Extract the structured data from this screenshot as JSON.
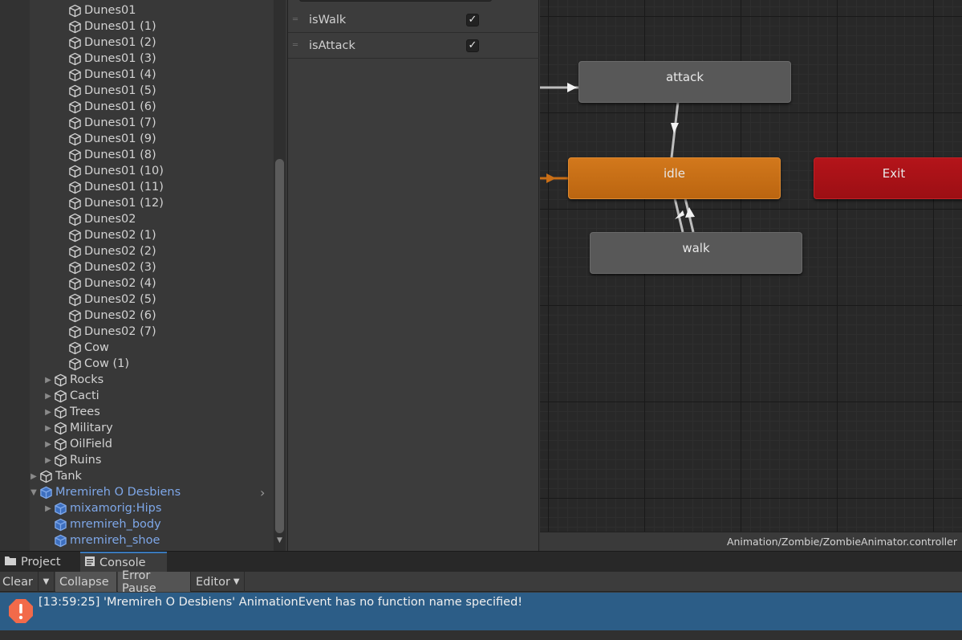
{
  "hierarchy": {
    "items": [
      {
        "label": "Dunes01",
        "indent": 6,
        "arrow": false,
        "prefab": false
      },
      {
        "label": "Dunes01 (1)",
        "indent": 6,
        "arrow": false,
        "prefab": false
      },
      {
        "label": "Dunes01 (2)",
        "indent": 6,
        "arrow": false,
        "prefab": false
      },
      {
        "label": "Dunes01 (3)",
        "indent": 6,
        "arrow": false,
        "prefab": false
      },
      {
        "label": "Dunes01 (4)",
        "indent": 6,
        "arrow": false,
        "prefab": false
      },
      {
        "label": "Dunes01 (5)",
        "indent": 6,
        "arrow": false,
        "prefab": false
      },
      {
        "label": "Dunes01 (6)",
        "indent": 6,
        "arrow": false,
        "prefab": false
      },
      {
        "label": "Dunes01 (7)",
        "indent": 6,
        "arrow": false,
        "prefab": false
      },
      {
        "label": "Dunes01 (9)",
        "indent": 6,
        "arrow": false,
        "prefab": false
      },
      {
        "label": "Dunes01 (8)",
        "indent": 6,
        "arrow": false,
        "prefab": false
      },
      {
        "label": "Dunes01 (10)",
        "indent": 6,
        "arrow": false,
        "prefab": false
      },
      {
        "label": "Dunes01 (11)",
        "indent": 6,
        "arrow": false,
        "prefab": false
      },
      {
        "label": "Dunes01 (12)",
        "indent": 6,
        "arrow": false,
        "prefab": false
      },
      {
        "label": "Dunes02",
        "indent": 6,
        "arrow": false,
        "prefab": false
      },
      {
        "label": "Dunes02 (1)",
        "indent": 6,
        "arrow": false,
        "prefab": false
      },
      {
        "label": "Dunes02 (2)",
        "indent": 6,
        "arrow": false,
        "prefab": false
      },
      {
        "label": "Dunes02 (3)",
        "indent": 6,
        "arrow": false,
        "prefab": false
      },
      {
        "label": "Dunes02 (4)",
        "indent": 6,
        "arrow": false,
        "prefab": false
      },
      {
        "label": "Dunes02 (5)",
        "indent": 6,
        "arrow": false,
        "prefab": false
      },
      {
        "label": "Dunes02 (6)",
        "indent": 6,
        "arrow": false,
        "prefab": false
      },
      {
        "label": "Dunes02 (7)",
        "indent": 6,
        "arrow": false,
        "prefab": false
      },
      {
        "label": "Cow",
        "indent": 6,
        "arrow": false,
        "prefab": false
      },
      {
        "label": "Cow (1)",
        "indent": 6,
        "arrow": false,
        "prefab": false
      },
      {
        "label": "Rocks",
        "indent": 5,
        "arrow": "right",
        "prefab": false
      },
      {
        "label": "Cacti",
        "indent": 5,
        "arrow": "right",
        "prefab": false
      },
      {
        "label": "Trees",
        "indent": 5,
        "arrow": "right",
        "prefab": false
      },
      {
        "label": "Military",
        "indent": 5,
        "arrow": "right",
        "prefab": false
      },
      {
        "label": "OilField",
        "indent": 5,
        "arrow": "right",
        "prefab": false
      },
      {
        "label": "Ruins",
        "indent": 5,
        "arrow": "right",
        "prefab": false
      },
      {
        "label": "Tank",
        "indent": 4,
        "arrow": "right",
        "prefab": false
      },
      {
        "label": "Mremireh O Desbiens",
        "indent": 4,
        "arrow": "down",
        "prefab": true,
        "more": true
      },
      {
        "label": "mixamorig:Hips",
        "indent": 5,
        "arrow": "right",
        "prefab": true
      },
      {
        "label": "mremireh_body",
        "indent": 5,
        "arrow": false,
        "prefab": true
      },
      {
        "label": "mremireh_shoe",
        "indent": 5,
        "arrow": false,
        "prefab": true
      }
    ]
  },
  "parameters": [
    {
      "name": "isWalk",
      "checked": true
    },
    {
      "name": "isAttack",
      "checked": true
    }
  ],
  "animator": {
    "states": {
      "attack": "attack",
      "idle": "idle",
      "walk": "walk",
      "exit": "Exit"
    },
    "path": "Animation/Zombie/ZombieAnimator.controller"
  },
  "tabs": {
    "project": "Project",
    "console": "Console"
  },
  "console": {
    "clear": "Clear",
    "collapse": "Collapse",
    "error_pause": "Error Pause",
    "editor": "Editor",
    "message": "[13:59:25] 'Mremireh O Desbiens' AnimationEvent has no function name specified!"
  },
  "colors": {
    "prefab_text": "#7ea7e8",
    "default_state": "#c96e16",
    "exit_state": "#a81117",
    "log_selected": "#2c5d87",
    "error_icon": "#f26a4a"
  }
}
